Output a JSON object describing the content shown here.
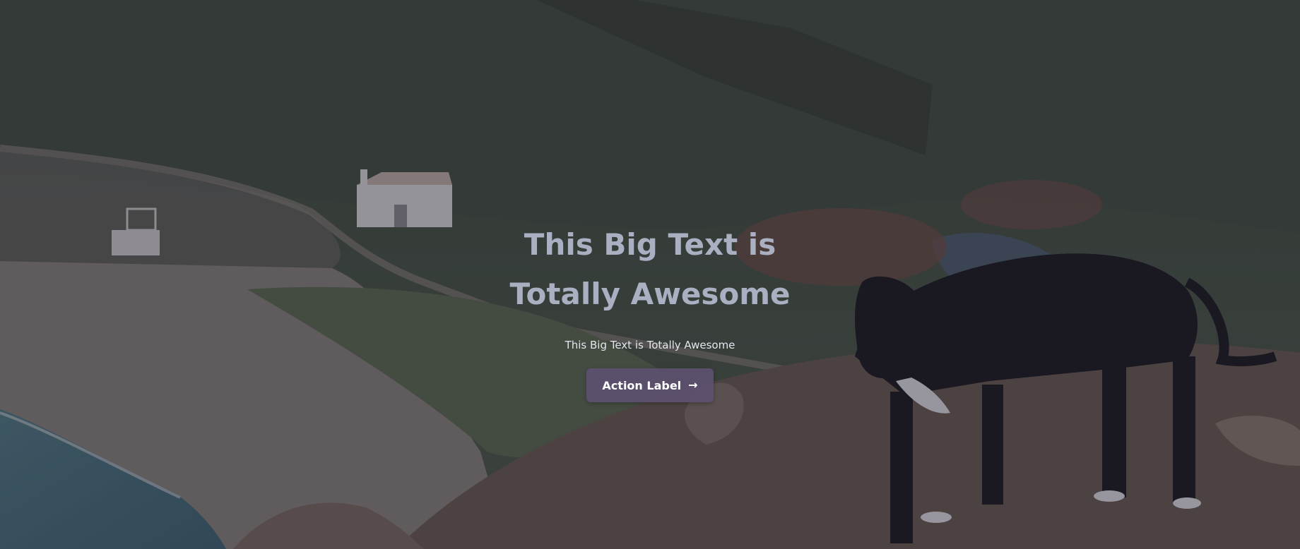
{
  "hero": {
    "title": "This Big Text is Totally Awesome",
    "subtitle": "This Big Text is Totally Awesome",
    "cta_label": "Action Label",
    "cta_icon": "arrow-right-icon"
  },
  "colors": {
    "overlay": "#262234",
    "title": "#aab0c2",
    "subtitle": "#e4e6ee",
    "button": "#5c5070",
    "button_text": "#ffffff"
  }
}
